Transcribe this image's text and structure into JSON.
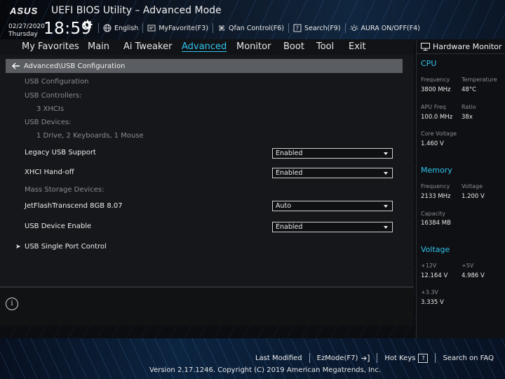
{
  "header": {
    "logo_text": "ASUS",
    "title": "UEFI BIOS Utility – Advanced Mode",
    "date": "02/27/2020",
    "day": "Thursday",
    "time": "18:59",
    "items": [
      {
        "label": "English",
        "icon": "globe-icon"
      },
      {
        "label": "MyFavorite(F3)",
        "icon": "favorite-icon"
      },
      {
        "label": "Qfan Control(F6)",
        "icon": "fan-icon"
      },
      {
        "label": "Search(F9)",
        "icon": "search-icon"
      },
      {
        "label": "AURA ON/OFF(F4)",
        "icon": "aura-icon"
      }
    ]
  },
  "menu": {
    "items": [
      "My Favorites",
      "Main",
      "Ai Tweaker",
      "Advanced",
      "Monitor",
      "Boot",
      "Tool",
      "Exit"
    ],
    "active": "Advanced"
  },
  "breadcrumb": "Advanced\\USB Configuration",
  "usb": {
    "heading": "USB Configuration",
    "controllers_label": "USB Controllers:",
    "controllers_value": "3 XHCIs",
    "devices_label": "USB Devices:",
    "devices_value": "1 Drive, 2 Keyboards, 1 Mouse",
    "legacy_label": "Legacy USB Support",
    "legacy_value": "Enabled",
    "xhci_label": "XHCI Hand-off",
    "xhci_value": "Enabled",
    "mass_label": "Mass Storage Devices:",
    "drive_label": "JetFlashTranscend 8GB 8.07",
    "drive_value": "Auto",
    "enable_label": "USB Device Enable",
    "enable_value": "Enabled",
    "single_port_label": "USB Single Port Control"
  },
  "hw": {
    "title": "Hardware Monitor",
    "cpu": {
      "title": "CPU",
      "frequency_label": "Frequency",
      "frequency": "3800 MHz",
      "temperature_label": "Temperature",
      "temperature": "48°C",
      "apu_label": "APU Freq",
      "apu": "100.0 MHz",
      "ratio_label": "Ratio",
      "ratio": "38x",
      "core_voltage_label": "Core Voltage",
      "core_voltage": "1.460 V"
    },
    "memory": {
      "title": "Memory",
      "frequency_label": "Frequency",
      "frequency": "2133 MHz",
      "voltage_label": "Voltage",
      "voltage": "1.200 V",
      "capacity_label": "Capacity",
      "capacity": "16384 MB"
    },
    "voltage": {
      "title": "Voltage",
      "v12_label": "+12V",
      "v12": "12.164 V",
      "v5_label": "+5V",
      "v5": "4.986 V",
      "v33_label": "+3.3V",
      "v33": "3.335 V"
    }
  },
  "footer": {
    "last_modified": "Last Modified",
    "ezmode": "EzMode(F7)",
    "hotkeys": "Hot Keys",
    "hotkeys_key": "?",
    "search_faq": "Search on FAQ",
    "copyright": "Version 2.17.1246. Copyright (C) 2019 American Megatrends, Inc."
  },
  "colors": {
    "accent": "#31c4ee",
    "breadcrumb_bg": "#5a5d61"
  }
}
